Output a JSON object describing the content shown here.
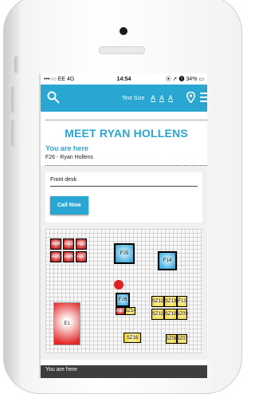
{
  "status_bar": {
    "carrier": "•••○○ EE  4G",
    "time": "14:54",
    "right": "⦿ ➚ ❶ 34% ▭"
  },
  "nav": {
    "text_size_label": "Text Size",
    "size_letters": [
      "A",
      "A",
      "A"
    ]
  },
  "meet": {
    "title": "MEET RYAN HOLLENS",
    "you_are_here_title": "You are here",
    "location_line": "F26 - Ryan Hollens"
  },
  "front_desk": {
    "label": "Front desk",
    "call_button": "Call Now"
  },
  "map": {
    "booths_red_small": [
      "A04",
      "A03",
      "A02",
      "A05",
      "A06",
      "A07"
    ],
    "booth_f25": "F25",
    "booth_f14": "F14",
    "booth_f26": "F26",
    "booth_a37": "A37",
    "booth_sz14": "SZ14",
    "booth_e1": "E1",
    "yellow_booths": [
      "SZ12",
      "SZ13",
      "F13",
      "SZ11",
      "SZ10",
      "SZ09"
    ],
    "booth_sz16": "SZ16",
    "booth_sz08": "SZ08",
    "booth_sz07": "SZ07"
  },
  "footer": {
    "text": "You are here"
  },
  "colors": {
    "accent": "#2aa6d3",
    "marker": "#e32020"
  }
}
